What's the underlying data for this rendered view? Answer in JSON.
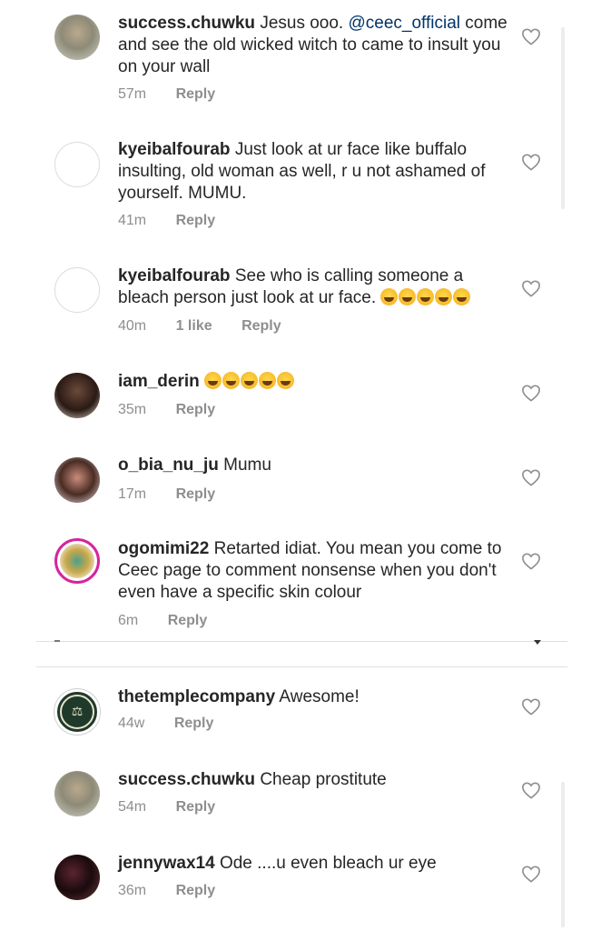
{
  "comments_top": [
    {
      "username": "success.chuwku",
      "text_before": "Jesus ooo. ",
      "mention": "@ceec_official",
      "text_after": " come and see the old wicked witch to came to insult you on your wall",
      "time": "57m",
      "reply": "Reply",
      "avatar": "photo-beige"
    },
    {
      "username": "kyeibalfourab",
      "text": "Just look at ur face like buffalo insulting, old woman as well, r u not ashamed of yourself. MUMU.",
      "time": "41m",
      "reply": "Reply",
      "avatar": "empty"
    },
    {
      "username": "kyeibalfourab",
      "text": "See who is calling someone a bleach person just look at ur face.",
      "emoji_count": 5,
      "time": "40m",
      "likes": "1 like",
      "reply": "Reply",
      "avatar": "empty"
    },
    {
      "username": "iam_derin",
      "text": "",
      "emoji_count": 5,
      "time": "35m",
      "reply": "Reply",
      "avatar": "photo-dark"
    },
    {
      "username": "o_bia_nu_ju",
      "text": "Mumu",
      "time": "17m",
      "reply": "Reply",
      "avatar": "photo-pink"
    },
    {
      "username": "ogomimi22",
      "text": "Retarted idiat. You mean you come to Ceec page to comment nonsense when you don't even have a specific skin colour",
      "time": "6m",
      "reply": "Reply",
      "avatar": "ring"
    }
  ],
  "comments_bottom": [
    {
      "username": "thetemplecompany",
      "text": "Awesome!",
      "time": "44w",
      "reply": "Reply",
      "avatar": "logo",
      "logo_glyph": "⚖"
    },
    {
      "username": "success.chuwku",
      "text": "Cheap prostitute",
      "time": "54m",
      "reply": "Reply",
      "avatar": "photo-beige"
    },
    {
      "username": "jennywax14",
      "text": "Ode ....u even bleach ur eye",
      "time": "36m",
      "reply": "Reply",
      "avatar": "jenny"
    }
  ],
  "icons": {
    "like": "heart-outline-icon"
  },
  "colors": {
    "text": "#262626",
    "meta": "#8e8e8e",
    "mention": "#003569"
  }
}
